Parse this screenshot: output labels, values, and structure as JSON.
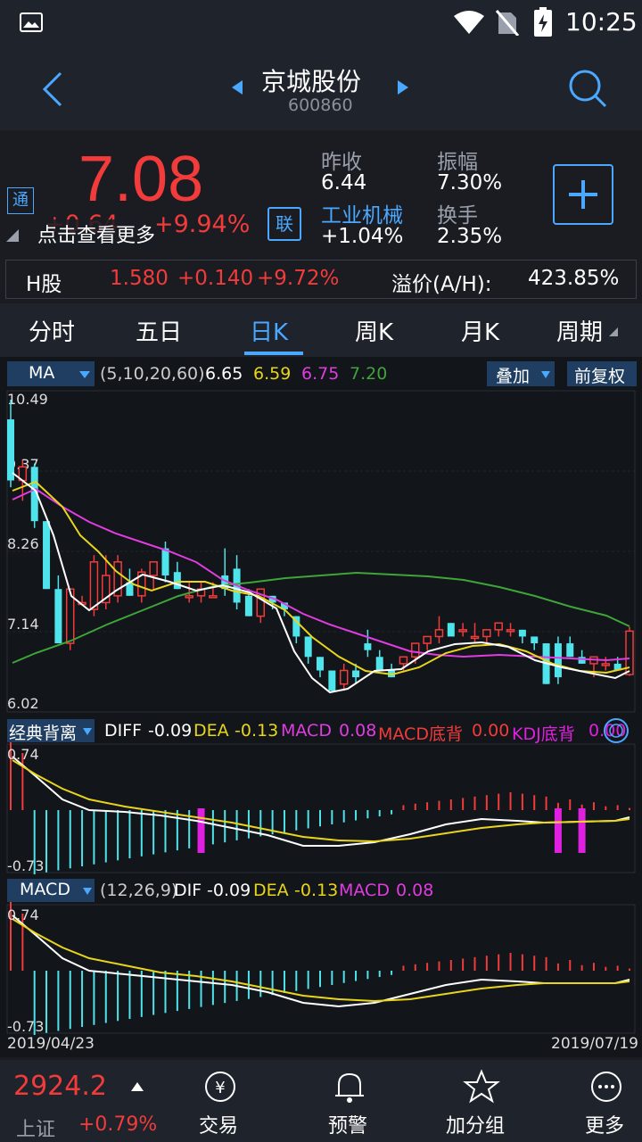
{
  "status_bar": {
    "time": "10:25"
  },
  "header": {
    "stock_name": "京城股份",
    "stock_code": "600860"
  },
  "quote": {
    "price": "7.08",
    "change": "+0.64",
    "change_pct": "+9.94%",
    "badge_tong": "通",
    "badge_lian": "联",
    "overlay_text": "点击查看更多",
    "prev_close_label": "昨收",
    "prev_close": "6.44",
    "amplitude_label": "振幅",
    "amplitude": "7.30%",
    "industry_label": "工业机械",
    "industry_change": "+1.04%",
    "turnover_label": "换手",
    "turnover": "2.35%"
  },
  "h_share": {
    "label": "H股",
    "price": "1.580",
    "change": "+0.140",
    "change_pct": "+9.72%",
    "premium_label": "溢价(A/H):",
    "premium": "423.85%"
  },
  "tabs": [
    "分时",
    "五日",
    "日K",
    "周K",
    "月K",
    "周期"
  ],
  "active_tab": 2,
  "ma_bar": {
    "name": "MA",
    "params": "(5,10,20,60)",
    "ma5": "6.65",
    "ma10": "6.59",
    "ma20": "6.75",
    "ma60": "7.20",
    "overlay": "叠加",
    "adjust": "前复权"
  },
  "price_axis": {
    "max": "10.49",
    "v2": "9.37",
    "v3": "8.26",
    "v4": "7.14",
    "min": "6.02"
  },
  "ind1": {
    "name": "经典背离",
    "diff_label": "DIFF",
    "diff": "-0.09",
    "dea_label": "DEA",
    "dea": "-0.13",
    "macd_label": "MACD",
    "macd": "0.08",
    "macd_div_label": "MACD底背",
    "macd_div": "0.00",
    "kdj_div_label": "KDJ底背",
    "kdj_div": "0.00",
    "max": "0.74",
    "min": "-0.73"
  },
  "ind2": {
    "name": "MACD",
    "params": "(12,26,9)",
    "dif_label": "DIF",
    "dif": "-0.09",
    "dea_label": "DEA",
    "dea": "-0.13",
    "macd_label": "MACD",
    "macd": "0.08",
    "max": "0.74",
    "min": "-0.73"
  },
  "dates": {
    "start": "2019/04/23",
    "end": "2019/07/19"
  },
  "bottom_nav": {
    "index_value": "2924.2",
    "index_name": "上证",
    "index_change": "+0.79%",
    "items": [
      "交易",
      "预警",
      "加分组",
      "更多"
    ]
  },
  "colors": {
    "up": "#f23b3b",
    "down": "#4fe3ec",
    "ma5": "#ffffff",
    "ma10": "#e8d51c",
    "ma20": "#e03ce0",
    "ma60": "#3fa43a",
    "accent": "#4aa8ff"
  },
  "chart_data": {
    "type": "candlestick",
    "ohlc": [
      [
        10.2,
        10.49,
        9.2,
        9.3
      ],
      [
        9.3,
        9.6,
        9.0,
        9.5
      ],
      [
        9.5,
        9.55,
        8.6,
        8.7
      ],
      [
        8.7,
        8.7,
        7.7,
        7.7
      ],
      [
        7.7,
        7.9,
        6.9,
        6.9
      ],
      [
        6.9,
        7.7,
        6.8,
        7.7
      ],
      [
        7.5,
        7.6,
        7.5,
        7.5
      ],
      [
        7.4,
        8.2,
        7.3,
        8.1
      ],
      [
        7.5,
        8.2,
        7.4,
        7.9
      ],
      [
        7.6,
        8.2,
        7.5,
        8.1
      ],
      [
        7.8,
        8.0,
        7.6,
        7.6
      ],
      [
        7.6,
        8.0,
        7.5,
        7.95
      ],
      [
        7.9,
        8.1,
        7.7,
        8.1
      ],
      [
        8.3,
        8.4,
        7.8,
        7.9
      ],
      [
        7.95,
        8.1,
        7.7,
        7.7
      ],
      [
        7.6,
        7.8,
        7.5,
        7.6
      ],
      [
        7.6,
        7.8,
        7.5,
        7.7
      ],
      [
        7.6,
        7.8,
        7.6,
        7.6
      ],
      [
        7.9,
        8.3,
        7.6,
        7.7
      ],
      [
        8.0,
        8.2,
        7.4,
        7.5
      ],
      [
        7.6,
        7.7,
        7.3,
        7.3
      ],
      [
        7.3,
        7.7,
        7.2,
        7.7
      ],
      [
        7.6,
        7.6,
        7.4,
        7.5
      ],
      [
        7.5,
        7.5,
        7.3,
        7.4
      ],
      [
        7.3,
        7.3,
        6.9,
        7.0
      ],
      [
        7.0,
        7.0,
        6.6,
        6.7
      ],
      [
        6.7,
        6.7,
        6.4,
        6.5
      ],
      [
        6.5,
        6.5,
        6.2,
        6.2
      ],
      [
        6.3,
        6.6,
        6.2,
        6.5
      ],
      [
        6.5,
        6.6,
        6.3,
        6.4
      ],
      [
        6.9,
        7.1,
        6.7,
        6.8
      ],
      [
        6.7,
        6.8,
        6.5,
        6.5
      ],
      [
        6.5,
        6.6,
        6.4,
        6.4
      ],
      [
        6.6,
        6.7,
        6.5,
        6.7
      ],
      [
        6.7,
        6.9,
        6.6,
        6.9
      ],
      [
        6.9,
        7.0,
        6.8,
        7.0
      ],
      [
        7.0,
        7.3,
        6.9,
        7.1
      ],
      [
        7.2,
        7.2,
        7.0,
        7.0
      ],
      [
        7.1,
        7.2,
        7.0,
        7.1
      ],
      [
        7.0,
        7.2,
        6.9,
        7.0
      ],
      [
        7.0,
        7.1,
        6.9,
        7.1
      ],
      [
        7.1,
        7.2,
        7.0,
        7.2
      ],
      [
        7.1,
        7.2,
        7.0,
        7.1
      ],
      [
        7.1,
        7.1,
        6.9,
        7.0
      ],
      [
        7.0,
        7.0,
        6.8,
        6.9
      ],
      [
        6.9,
        6.9,
        6.3,
        6.3
      ],
      [
        6.9,
        7.0,
        6.3,
        6.4
      ],
      [
        6.9,
        7.0,
        6.7,
        6.7
      ],
      [
        6.7,
        6.8,
        6.6,
        6.6
      ],
      [
        6.6,
        6.7,
        6.4,
        6.7
      ],
      [
        6.6,
        6.7,
        6.5,
        6.6
      ],
      [
        6.6,
        6.7,
        6.5,
        6.5
      ],
      [
        6.44,
        7.14,
        6.42,
        7.08
      ]
    ]
  }
}
